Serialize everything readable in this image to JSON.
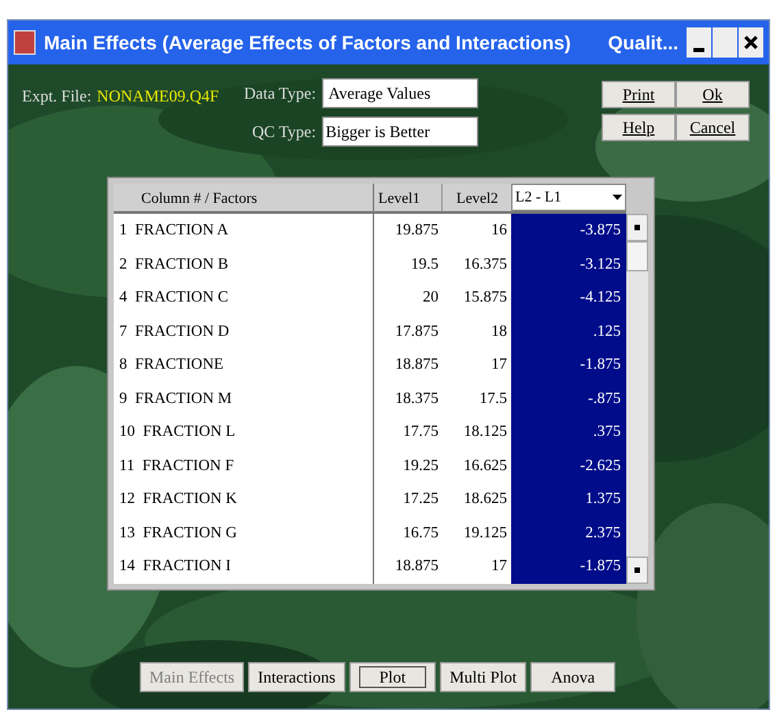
{
  "window": {
    "title": "Main Effects (Average Effects of Factors and Interactions)",
    "app_title": "Qualit..."
  },
  "expt_file": {
    "label": "Expt. File:",
    "value": "NONAME09.Q4F"
  },
  "data_type": {
    "label": "Data Type:",
    "value": "Average Values"
  },
  "qc_type": {
    "label": "QC Type:",
    "value": "Bigger is Better"
  },
  "side_buttons": [
    "Print",
    "Ok",
    "Help",
    "Cancel"
  ],
  "table": {
    "columns": [
      "Column # / Factors",
      "Level1",
      "Level2"
    ],
    "selector": "L2 - L1",
    "rows": [
      {
        "factor": "1  FRACTION A",
        "level1": "19.875",
        "level2": "16",
        "diff": "-3.875"
      },
      {
        "factor": "2  FRACTION B",
        "level1": "19.5",
        "level2": "16.375",
        "diff": "-3.125"
      },
      {
        "factor": "4  FRACTION C",
        "level1": "20",
        "level2": "15.875",
        "diff": "-4.125"
      },
      {
        "factor": "7  FRACTION D",
        "level1": "17.875",
        "level2": "18",
        "diff": ".125"
      },
      {
        "factor": "8  FRACTIONE",
        "level1": "18.875",
        "level2": "17",
        "diff": "-1.875"
      },
      {
        "factor": "9  FRACTION M",
        "level1": "18.375",
        "level2": "17.5",
        "diff": "-.875"
      },
      {
        "factor": "10  FRACTION L",
        "level1": "17.75",
        "level2": "18.125",
        "diff": ".375"
      },
      {
        "factor": "11  FRACTION F",
        "level1": "19.25",
        "level2": "16.625",
        "diff": "-2.625"
      },
      {
        "factor": "12  FRACTION K",
        "level1": "17.25",
        "level2": "18.625",
        "diff": "1.375"
      },
      {
        "factor": "13  FRACTION G",
        "level1": "16.75",
        "level2": "19.125",
        "diff": "2.375"
      },
      {
        "factor": "14  FRACTION I",
        "level1": "18.875",
        "level2": "17",
        "diff": "-1.875"
      }
    ]
  },
  "bottom_buttons": [
    {
      "label": "Main Effects",
      "disabled": true,
      "focused": false
    },
    {
      "label": "Interactions",
      "disabled": false,
      "focused": false
    },
    {
      "label": "Plot",
      "disabled": false,
      "focused": true
    },
    {
      "label": "Multi Plot",
      "disabled": false,
      "focused": false
    },
    {
      "label": "Anova",
      "disabled": false,
      "focused": false
    }
  ]
}
